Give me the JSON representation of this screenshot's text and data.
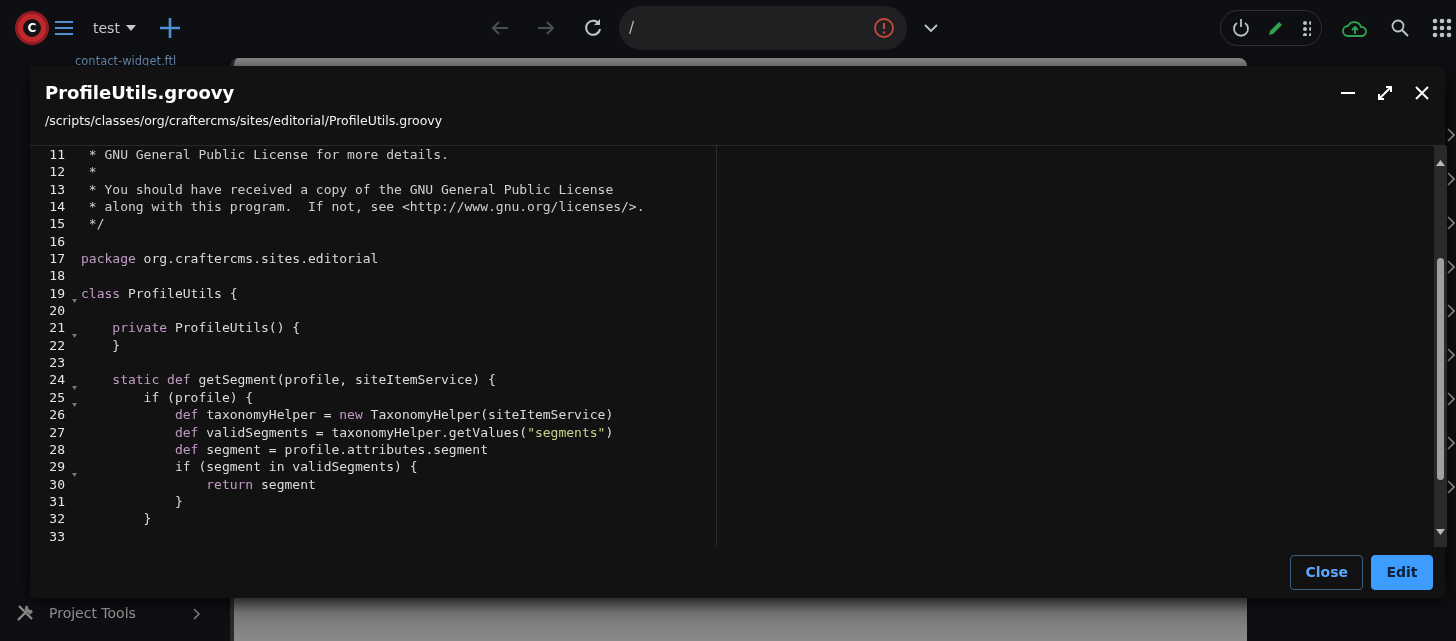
{
  "top_bar": {
    "logo_letter": "C",
    "site": "test",
    "address": "/",
    "back_disabled": true,
    "forward_disabled": true,
    "address_error": true,
    "preview_on": true
  },
  "background": {
    "tab_label": "contact-widget.ftl",
    "sidebar_item": "Project Tools"
  },
  "dialog": {
    "title": "ProfileUtils.groovy",
    "path": "/scripts/classes/org/craftercms/sites/editorial/ProfileUtils.groovy",
    "code_lines": [
      {
        "number": "11",
        "foldable": false,
        "tokens": [
          {
            "kind": "comment",
            "text": " * GNU General Public License for more details."
          }
        ]
      },
      {
        "number": "12",
        "foldable": false,
        "tokens": [
          {
            "kind": "comment",
            "text": " *"
          }
        ]
      },
      {
        "number": "13",
        "foldable": false,
        "tokens": [
          {
            "kind": "comment",
            "text": " * You should have received a copy of the GNU General Public License"
          }
        ]
      },
      {
        "number": "14",
        "foldable": false,
        "tokens": [
          {
            "kind": "comment",
            "text": " * along with this program.  If not, see <http://www.gnu.org/licenses/>."
          }
        ]
      },
      {
        "number": "15",
        "foldable": false,
        "tokens": [
          {
            "kind": "comment",
            "text": " */"
          }
        ]
      },
      {
        "number": "16",
        "foldable": false
      },
      {
        "number": "17",
        "foldable": false,
        "tokens": [
          {
            "kind": "keyword",
            "text": "package"
          },
          {
            "kind": "plain",
            "text": " org.craftercms.sites.editorial"
          }
        ]
      },
      {
        "number": "18",
        "foldable": false
      },
      {
        "number": "19",
        "foldable": true,
        "tokens": [
          {
            "kind": "keyword",
            "text": "class"
          },
          {
            "kind": "plain",
            "text": " ProfileUtils {"
          }
        ]
      },
      {
        "number": "20",
        "foldable": false
      },
      {
        "number": "21",
        "foldable": true,
        "tokens": [
          {
            "kind": "keyword",
            "text": "    private"
          },
          {
            "kind": "plain",
            "text": " ProfileUtils() {"
          }
        ]
      },
      {
        "number": "22",
        "foldable": false,
        "tokens": [
          {
            "kind": "plain",
            "text": "    }"
          }
        ]
      },
      {
        "number": "23",
        "foldable": false
      },
      {
        "number": "24",
        "foldable": true,
        "tokens": [
          {
            "kind": "keyword",
            "text": "    static def"
          },
          {
            "kind": "plain",
            "text": " getSegment(profile, siteItemService) {"
          }
        ]
      },
      {
        "number": "25",
        "foldable": true,
        "tokens": [
          {
            "kind": "plain",
            "text": "        if (profile) {"
          }
        ]
      },
      {
        "number": "26",
        "foldable": false,
        "tokens": [
          {
            "kind": "keyword",
            "text": "            def"
          },
          {
            "kind": "plain",
            "text": " taxonomyHelper = "
          },
          {
            "kind": "keyword",
            "text": "new"
          },
          {
            "kind": "plain",
            "text": " TaxonomyHelper(siteItemService)"
          }
        ]
      },
      {
        "number": "27",
        "foldable": false,
        "tokens": [
          {
            "kind": "keyword",
            "text": "            def"
          },
          {
            "kind": "plain",
            "text": " validSegments = taxonomyHelper.getValues("
          },
          {
            "kind": "string",
            "text": "\"segments\""
          },
          {
            "kind": "plain",
            "text": ")"
          }
        ]
      },
      {
        "number": "28",
        "foldable": false,
        "tokens": [
          {
            "kind": "keyword",
            "text": "            def"
          },
          {
            "kind": "plain",
            "text": " segment = profile.attributes.segment"
          }
        ]
      },
      {
        "number": "29",
        "foldable": true,
        "tokens": [
          {
            "kind": "plain",
            "text": "            if (segment in validSegments) {"
          }
        ]
      },
      {
        "number": "30",
        "foldable": false,
        "tokens": [
          {
            "kind": "keyword",
            "text": "                return"
          },
          {
            "kind": "plain",
            "text": " segment"
          }
        ]
      },
      {
        "number": "31",
        "foldable": false,
        "tokens": [
          {
            "kind": "plain",
            "text": "            }"
          }
        ]
      },
      {
        "number": "32",
        "foldable": false,
        "tokens": [
          {
            "kind": "plain",
            "text": "        }"
          }
        ]
      },
      {
        "number": "33",
        "foldable": false
      }
    ],
    "buttons": [
      {
        "label": "Close",
        "kind": "outline"
      },
      {
        "label": "Edit",
        "kind": "primary"
      }
    ]
  }
}
